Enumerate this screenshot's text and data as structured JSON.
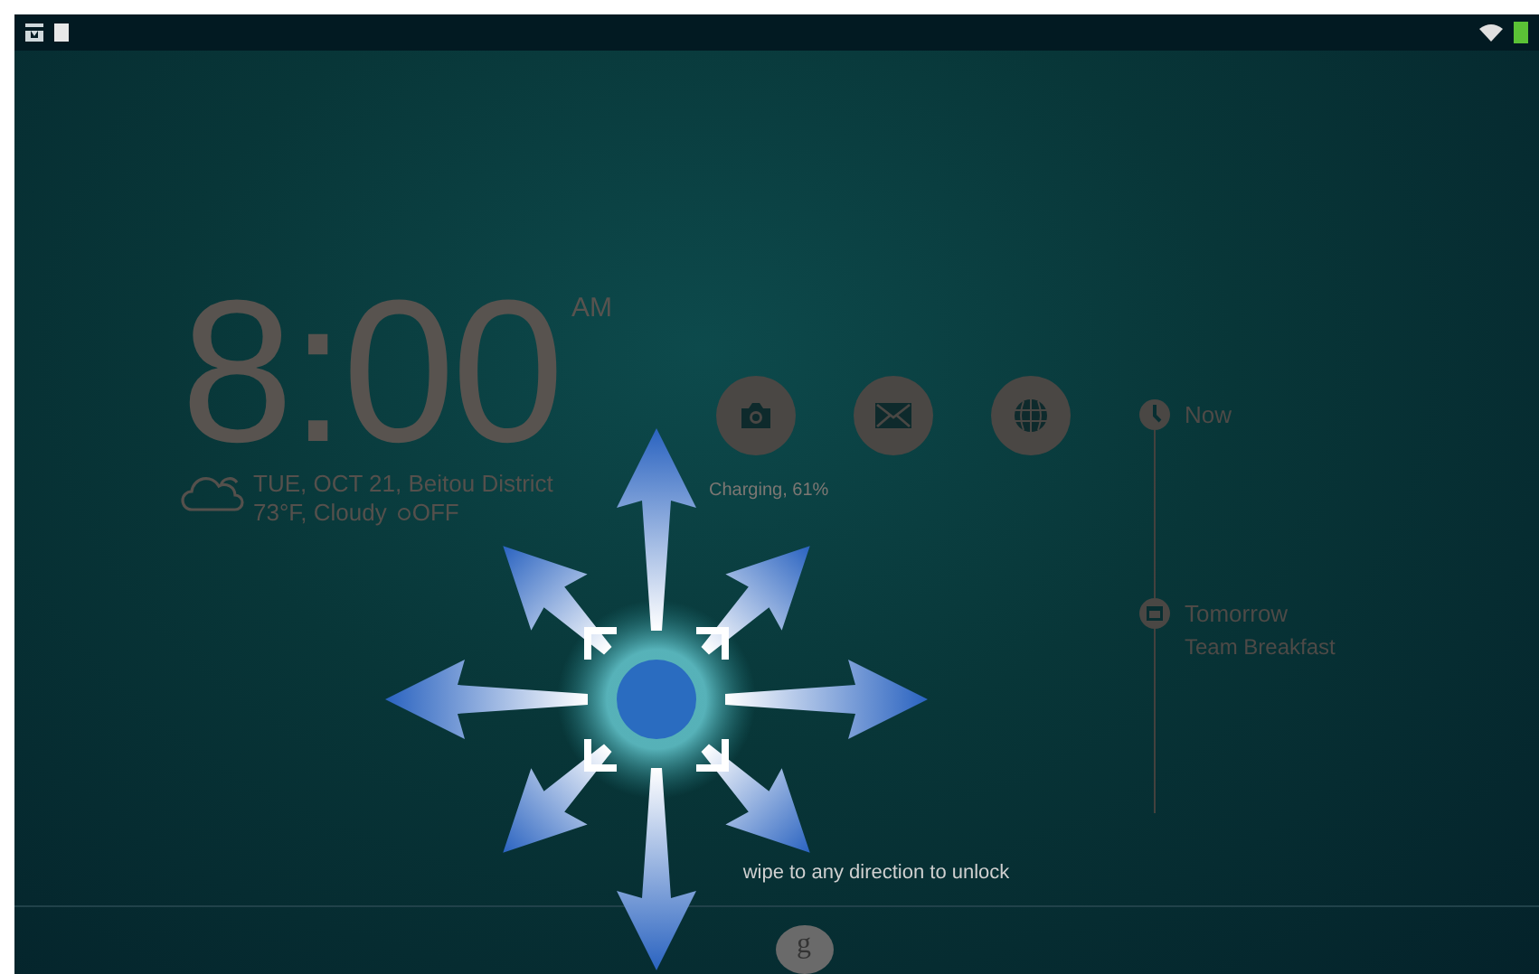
{
  "clock": {
    "time": "8:00",
    "meridiem": "AM"
  },
  "weather": {
    "line_1": "TUE, OCT 21, Beitou District",
    "line_2": "73°F, Cloudy",
    "alarm": "OFF"
  },
  "shortcuts": [
    {
      "kind": "camera"
    },
    {
      "kind": "mail"
    },
    {
      "kind": "browser"
    }
  ],
  "charging": "Charging, 61%",
  "timeline": [
    {
      "kind": "time",
      "title": "Now"
    },
    {
      "kind": "calendar",
      "title": "Tomorrow",
      "detail": "Team Breakfast"
    }
  ],
  "unlock_hint": "wipe to any direction to unlock",
  "google_button": {
    "label": "g"
  }
}
